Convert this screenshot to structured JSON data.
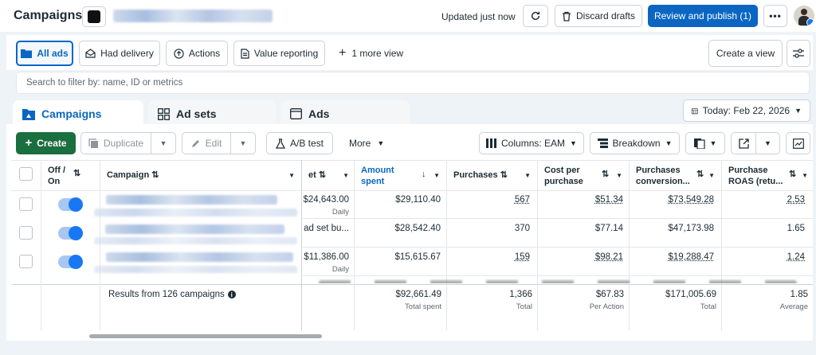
{
  "header": {
    "title": "Campaigns",
    "updated": "Updated just now",
    "discard_label": "Discard drafts",
    "publish_label": "Review and publish (1)"
  },
  "views": {
    "items": [
      "All ads",
      "Had delivery",
      "Actions",
      "Value reporting"
    ],
    "more_view": "1 more view",
    "create_view": "Create a view"
  },
  "search": {
    "placeholder": "Search to filter by: name, ID or metrics"
  },
  "tabs": {
    "campaigns": "Campaigns",
    "adsets": "Ad sets",
    "ads": "Ads"
  },
  "date": {
    "label": "Today: Feb 22, 2026"
  },
  "toolbar": {
    "create": "Create",
    "duplicate": "Duplicate",
    "edit": "Edit",
    "abtest": "A/B test",
    "more": "More",
    "columns": "Columns: EAM",
    "breakdown": "Breakdown"
  },
  "table": {
    "headers": {
      "offon": "Off / On",
      "campaign": "Campaign",
      "budget": "et",
      "amount": "Amount spent",
      "purchases": "Purchases",
      "cpp": "Cost per purchase",
      "pcv": "Purchases conversion...",
      "roas": "Purchase ROAS (retu..."
    },
    "rows": [
      {
        "budget": "$24,643.00",
        "budget_sub": "Daily",
        "amount": "$29,110.40",
        "purchases": "567",
        "cpp": "$51.34",
        "pcv": "$73,549.28",
        "roas": "2.53"
      },
      {
        "budget": "ad set bu...",
        "budget_sub": "",
        "amount": "$28,542.40",
        "purchases": "370",
        "cpp": "$77.14",
        "pcv": "$47,173.98",
        "roas": "1.65"
      },
      {
        "budget": "$11,386.00",
        "budget_sub": "Daily",
        "amount": "$15,615.67",
        "purchases": "159",
        "cpp": "$98.21",
        "pcv": "$19,288.47",
        "roas": "1.24"
      }
    ],
    "totals": {
      "label": "Results from 126 campaigns",
      "amount": "$92,661.49",
      "amount_sub": "Total spent",
      "purchases": "1,366",
      "purchases_sub": "Total",
      "cpp": "$67.83",
      "cpp_sub": "Per Action",
      "pcv": "$171,005.69",
      "pcv_sub": "Total",
      "roas": "1.85",
      "roas_sub": "Average"
    }
  },
  "colors": {
    "primary": "#0a66c2",
    "create": "#1b6e3f",
    "toggle": "#1877f2"
  }
}
